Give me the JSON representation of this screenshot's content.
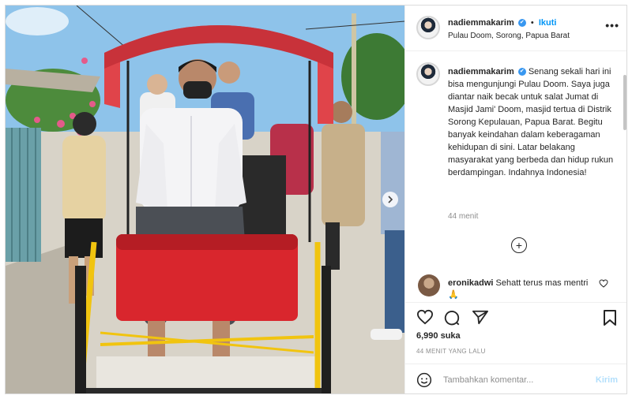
{
  "post": {
    "username": "nadiemmakarim",
    "verified_mark": "✔",
    "separator": "•",
    "follow_label": "Ikuti",
    "location": "Pulau Doom, Sorong, Papua Barat",
    "more_label": "•••"
  },
  "caption": {
    "username": "nadiemmakarim",
    "text": "Senang sekali hari ini bisa mengunjungi Pulau Doom. Saya juga diantar naik becak untuk salat Jumat di Masjid Jami' Doom, masjid tertua di Distrik Sorong Kepulauan, Papua Barat. Begitu banyak keindahan dalam keberagaman kehidupan di sini. Latar belakang masyarakat yang berbeda dan hidup rukun berdampingan. Indahnya Indonesia!",
    "time": "44 menit"
  },
  "load_more_label": "+",
  "comment": {
    "username": "eronikadwi",
    "text": "Sehatt terus mas mentri 🙏"
  },
  "actions": {
    "likes": "6,990 suka",
    "posted": "44 MENIT YANG LALU"
  },
  "comment_box": {
    "placeholder": "Tambahkan komentar...",
    "post_label": "Kirim"
  },
  "icons": {
    "like": "heart-icon",
    "comment": "comment-icon",
    "share": "share-icon",
    "save": "bookmark-icon",
    "emoji": "emoji-icon",
    "next": "chevron-right-icon",
    "verified": "verified-badge-icon"
  },
  "colors": {
    "accent": "#0095f6",
    "verified": "#3897f0",
    "muted": "#8e8e8e",
    "canopy": "#e0444a",
    "seat": "#d9262d",
    "frame_yellow": "#f1c40f"
  }
}
